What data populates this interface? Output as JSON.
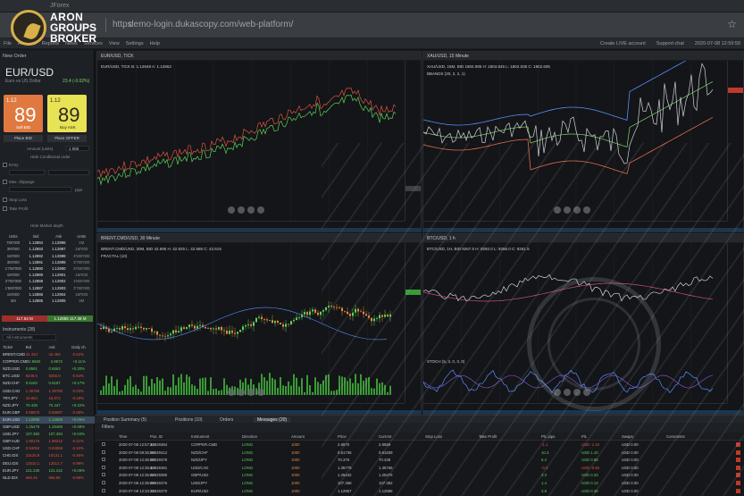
{
  "window": {
    "title": "JForex"
  },
  "browser": {
    "protocol": "https",
    "url": "demo-login.dukascopy.com/web-platform/"
  },
  "logo": {
    "line1": "ARON",
    "line2": "GROUPS",
    "line3": "BROKER"
  },
  "menu": {
    "items": [
      "File",
      "Account",
      "Reports",
      "News",
      "Services",
      "View",
      "Settings",
      "Help"
    ],
    "right": [
      "Create LIVE account",
      "Support chat",
      "2020-07-08 12:59:59"
    ]
  },
  "order": {
    "header": "New Order",
    "pair": "EUR/USD",
    "pair_desc": "Euro vs US Dollar",
    "change": "23.4 (-0.02%)",
    "sell": {
      "small": "1.12",
      "big": "89",
      "sup": "5",
      "label": "Sell BID",
      "spread": "0.6"
    },
    "buy": {
      "small": "1.12",
      "big": "89",
      "sup": "6",
      "label": "Buy ASK",
      "spread": "0.8"
    },
    "place_bid": "Place BID",
    "place_offer": "Place OFFER",
    "amount_label": "Amount (units)",
    "amount_value": "1 000",
    "hide_conditional": "Hide Conditional order",
    "entry": "Entry",
    "max_slippage": "Max. Slippage",
    "pips": "pips",
    "stop_loss": "Stop Loss",
    "take_profit": "Take Profit",
    "hide_market_depth": "Hide Market depth"
  },
  "depth": {
    "headers": [
      "Units",
      "Bid",
      "Ask",
      "Units"
    ],
    "rows": [
      [
        "750'000",
        "1.12894",
        "1.12896",
        "1M"
      ],
      [
        "3M'000",
        "1.12893",
        "1.12897",
        "1M'000"
      ],
      [
        "1M'000",
        "1.12892",
        "1.12898",
        "4'500'000"
      ],
      [
        "3M'000",
        "1.12891",
        "1.12899",
        "3'750'000"
      ],
      [
        "1'750'000",
        "1.12890",
        "1.12900",
        "3'000'000"
      ],
      [
        "1M'000",
        "1.12889",
        "1.12901",
        "1M'000"
      ],
      [
        "3'750'000",
        "1.12888",
        "1.12902",
        "1'500'000"
      ],
      [
        "1'500'000",
        "1.12887",
        "1.12903",
        "3'750'000"
      ],
      [
        "1M'000",
        "1.12886",
        "1.12904",
        "1M'000"
      ],
      [
        "3M",
        "1.12885",
        "1.12905",
        "3M"
      ]
    ],
    "total_left": "117.54 M",
    "total_right": "1.12885 117.38 M"
  },
  "instruments": {
    "title": "Instruments (28)",
    "filter": "All instruments",
    "headers": [
      "Ticker",
      "Bid",
      "Ask",
      "Daily ch."
    ],
    "rows": [
      {
        "t": "BRENT.CMD",
        "b": "42.434",
        "a": "42.454",
        "d": "-0.52%",
        "dir": "dn"
      },
      {
        "t": "COPPER.CMD",
        "b": "2.8560",
        "a": "2.8573",
        "d": "+0.11%",
        "dir": "up"
      },
      {
        "t": "NZD.USD",
        "b": "0.6561",
        "a": "0.6563",
        "d": "+0.20%",
        "dir": "up"
      },
      {
        "t": "BTC.USD",
        "b": "9249.6",
        "a": "9256.9",
        "d": "-0.54%",
        "dir": "dn"
      },
      {
        "t": "NZD.CHF",
        "b": "0.6183",
        "a": "0.6187",
        "d": "+0.17%",
        "dir": "up"
      },
      {
        "t": "USD.CAD",
        "b": "1.35766",
        "a": "1.35790",
        "d": "-0.03%",
        "dir": "dn"
      },
      {
        "t": "TRY.JPY",
        "b": "15.654",
        "a": "15.672",
        "d": "-0.18%",
        "dir": "dn"
      },
      {
        "t": "NZD.JPY",
        "b": "70.438",
        "a": "70.447",
        "d": "+0.22%",
        "dir": "up"
      },
      {
        "t": "EUR.GBP",
        "b": "0.89970",
        "a": "0.89987",
        "d": "-0.08%",
        "dir": "dn"
      },
      {
        "t": "EUR.USD",
        "b": "1.12895",
        "a": "1.12896",
        "d": "+0.05%",
        "dir": "up"
      },
      {
        "t": "GBP.USD",
        "b": "1.25475",
        "a": "1.25485",
        "d": "+0.08%",
        "dir": "up"
      },
      {
        "t": "USD.JPY",
        "b": "107.382",
        "a": "107.394",
        "d": "+0.04%",
        "dir": "up"
      },
      {
        "t": "GBP.AUD",
        "b": "1.80176",
        "a": "1.80212",
        "d": "-0.21%",
        "dir": "dn"
      },
      {
        "t": "USD.CHF",
        "b": "0.94052",
        "a": "0.94068",
        "d": "-0.10%",
        "dir": "dn"
      },
      {
        "t": "CHE.IDX",
        "b": "10125.8",
        "a": "10131.1",
        "d": "-0.46%",
        "dir": "dn"
      },
      {
        "t": "DEU.IDX",
        "b": "12510.1",
        "a": "12512.7",
        "d": "-0.99%",
        "dir": "dn"
      },
      {
        "t": "EUR.JPY",
        "b": "121.230",
        "a": "121.242",
        "d": "+0.09%",
        "dir": "up"
      },
      {
        "t": "NLD.IDX",
        "b": "566.45",
        "a": "566.85",
        "d": "-0.88%",
        "dir": "dn"
      }
    ]
  },
  "charts": [
    {
      "tab": "EUR/USD, TICK",
      "info": "EUR/USD, TICK B: 1.12848 A: 1.12863",
      "ind": ""
    },
    {
      "tab": "XAU/USD, 15 Minute",
      "info": "XAU/USD, 15M, BID 1804.085 H: 1804.845 L: 1802.035 C: 1802.605",
      "ind": "BBANDS (20, 2, 2, 1)"
    },
    {
      "tab": "BRENT.CMD/USD, 30 Minute",
      "info": "BRENT.CMD/USD, 30M, BID 42.695 H: 42.825 L: 42.585 C: 42.615",
      "ind": "FRACTAL (10)"
    },
    {
      "tab": "BTC/USD, 1 h",
      "info": "BTC/USD, 1H, BID 9267.5 H: 9292.0 L: 9256.0 C: 9261.5",
      "ind": "STOCH (5, 3, 0, 3, 0)"
    }
  ],
  "bottom": {
    "tabs": [
      "Position Summary (5)",
      "Positions (10)",
      "Orders",
      "Messages (20)"
    ],
    "filters": "Filters",
    "headers": [
      "Time",
      "Pos. ID",
      "Instrument",
      "Direction",
      "Amount",
      "Price",
      "Current",
      "Stop Loss",
      "Take Profit",
      "P/L pips",
      "P/L",
      "Swaps",
      "Comments"
    ],
    "rows": [
      [
        "2020-07-08 12:57:44",
        "20929384",
        "COPPER.CMD",
        "LONG",
        "1000",
        "2.8570",
        "2.8559",
        "",
        "",
        "-1.1",
        "USD -1.10",
        "USD 0.00"
      ],
      [
        "2020-07-08 08:36:05",
        "20929412",
        "NZD/CHF",
        "LONG",
        "1000",
        "0.61736",
        "0.61839",
        "",
        "",
        "10.3",
        "USD 1.10",
        "USD 0.00"
      ],
      [
        "2020-07-08 12:36:08",
        "20929379",
        "NZD/JPY",
        "LONG",
        "1000",
        "70.376",
        "70.438",
        "",
        "",
        "6.2",
        "USD 0.58",
        "USD 0.00"
      ],
      [
        "2020-07-08 12:36:43",
        "20929381",
        "USD/CAD",
        "LONG",
        "1000",
        "1.35775",
        "1.35766",
        "",
        "",
        "-0.9",
        "USD -0.66",
        "USD 0.00"
      ],
      [
        "2020-07-08 12:35:02",
        "20929380",
        "GBP/USD",
        "LONG",
        "1000",
        "1.25442",
        "1.25475",
        "",
        "",
        "3.3",
        "USD 0.33",
        "USD 0.00"
      ],
      [
        "2020-07-08 12:35:09",
        "20929376",
        "USD/JPY",
        "LONG",
        "1000",
        "107.368",
        "107.382",
        "",
        "",
        "1.4",
        "USD 0.13",
        "USD 0.00"
      ],
      [
        "2020-07-08 12:33:21",
        "20929370",
        "EUR/USD",
        "LONG",
        "1000",
        "1.12857",
        "1.12895",
        "",
        "",
        "3.8",
        "USD 0.38",
        "USD 0.00"
      ]
    ]
  },
  "colors": {
    "accent": "#3b4a5c",
    "up": "#5fcf58",
    "down": "#e0523f",
    "sell": "#e0793f",
    "buy": "#e8e255"
  }
}
